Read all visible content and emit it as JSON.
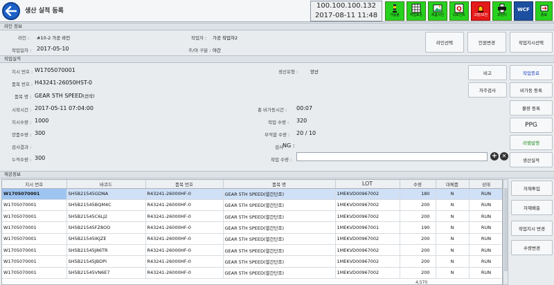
{
  "header": {
    "title": "생산 실적 등록",
    "ip": "100.100.100.132",
    "datetime": "2017-08-11 11:48",
    "tools": [
      {
        "label": "가동율",
        "icon": "signal-tower-icon",
        "color": "green"
      },
      {
        "label": "작업표준",
        "icon": "document-grid-icon",
        "color": "green"
      },
      {
        "label": "제품사진",
        "icon": "photo-icon",
        "color": "green"
      },
      {
        "label": "Q포인트",
        "icon": "q-point-icon",
        "color": "green"
      },
      {
        "label": "고장/보전",
        "icon": "alarm-icon",
        "color": "red"
      },
      {
        "label": "프린터",
        "icon": "printer-icon",
        "color": "green"
      },
      {
        "label": "WCF",
        "icon": "wcf-icon",
        "color": "blue"
      },
      {
        "label": "종료",
        "icon": "exit-icon",
        "color": "green"
      }
    ]
  },
  "line_info": {
    "section_title": "라인 정보",
    "line_label": "라인 :",
    "line_value": "#10-2 가공 라인",
    "worker_label": "작업자 :",
    "worker_value": "가공 작업자2",
    "workdate_label": "작업일자 :",
    "workdate_value": "2017-05-10",
    "shift_label": "주/야 구분 :",
    "shift_value": "야간",
    "buttons": {
      "line_select": "라인선택",
      "staff_change": "인원변경",
      "order_select": "작업지시선택"
    }
  },
  "performance": {
    "section_title": "작업실적",
    "order_no_label": "지시 번호 :",
    "order_no": "W1705070001",
    "prod_type_label": "생산유형 :",
    "prod_type": "양산",
    "part_no_label": "품목 번호 :",
    "part_no": "H43241-26050HST-0",
    "part_name_label": "품목 명 :",
    "part_name": "GEAR 5TH SPEED",
    "part_name_suffix": "(선삭)",
    "start_label": "시작시간 :",
    "start_time": "2017-05-11 07:04:00",
    "downtime_label": "총 비가동시간 :",
    "downtime": "00:07",
    "order_qty_label": "지시수량 :",
    "order_qty": "1000",
    "work_qty_label": "작업 수량 :",
    "work_qty": "320",
    "good_qty_label": "양품수량 :",
    "good_qty": "300",
    "defect_qty_label": "부적합 수량 :",
    "defect_qty": "20 / 10",
    "inspect_result_label": "검사결과 :",
    "inspect_result": "",
    "inspect_label": "검사",
    "inspect_value": "NG :",
    "cum_qty_label": "누적수량 :",
    "cum_qty": "300",
    "input_qty_label": "작업 수량 :",
    "input_qty_value": ""
  },
  "side_buttons": {
    "remark": "비고",
    "work_end": "작업종료",
    "self_inspect": "자주검사",
    "downtime_reg": "비가동 등록",
    "defect_reg": "불량 등록",
    "ppg": "PPG",
    "label_issue": "라벨발행",
    "prod_result": "생산실적"
  },
  "material": {
    "section_title": "재공정보",
    "columns": [
      "지시 번호",
      "바코드",
      "품목 번호",
      "품목 명",
      "LOT",
      "수량",
      "대체품",
      "상태"
    ],
    "rows": [
      [
        "W1705070001",
        "SH5B21545GDNA",
        "R43241-26000HF-0",
        "GEAR 5TH SPEED(열간단조)",
        "1MEKVD00967002",
        "180",
        "N",
        "RUN"
      ],
      [
        "W1705070001",
        "SH5B21545BQM4C",
        "R43241-26000HF-0",
        "GEAR 5TH SPEED(열간단조)",
        "1MEKVD00967002",
        "200",
        "N",
        "RUN"
      ],
      [
        "W1705070001",
        "SH5B21545C6LJ2",
        "R43241-26000HF-0",
        "GEAR 5TH SPEED(열간단조)",
        "1MEKVD00967002",
        "200",
        "N",
        "RUN"
      ],
      [
        "W1705070001",
        "SH5B21545FZ8OO",
        "R43241-26000HF-0",
        "GEAR 5TH SPEED(열간단조)",
        "1MEKVD00967001",
        "190",
        "N",
        "RUN"
      ],
      [
        "W1705070001",
        "SH5B21545IKJZE",
        "R43241-26000HF-0",
        "GEAR 5TH SPEED(열간단조)",
        "1MEKVD00967002",
        "200",
        "N",
        "RUN"
      ],
      [
        "W1705070001",
        "SH5B21545J86TR",
        "R43241-26000HF-0",
        "GEAR 5TH SPEED(열간단조)",
        "1MEKVD00967002",
        "200",
        "N",
        "RUN"
      ],
      [
        "W1705070001",
        "SH5B21545JBDPI",
        "R43241-26000HF-0",
        "GEAR 5TH SPEED(열간단조)",
        "1MEKVD00967002",
        "200",
        "N",
        "RUN"
      ],
      [
        "W1705070001",
        "SH5B21545VN6E7",
        "R43241-26000HF-0",
        "GEAR 5TH SPEED(열간단조)",
        "1MEKVD00967002",
        "200",
        "N",
        "RUN"
      ]
    ],
    "bottom_total": "4,570",
    "buttons": {
      "mat_input": "자재투입",
      "mat_return": "자재배출",
      "order_change": "작업지시 변경",
      "qty_change": "수량변경"
    }
  }
}
